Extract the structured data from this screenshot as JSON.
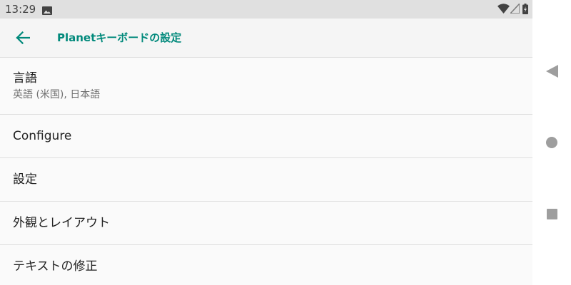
{
  "status_bar": {
    "time": "13:29",
    "icons": [
      "image-icon",
      "wifi-icon",
      "cell-signal-icon",
      "battery-icon"
    ]
  },
  "toolbar": {
    "title": "Planetキーボードの設定",
    "back_icon": "arrow-left-icon",
    "accent_color": "#00897b"
  },
  "settings": {
    "items": [
      {
        "title": "言語",
        "summary": "英語 (米国), 日本語"
      },
      {
        "title": "Configure"
      },
      {
        "title": "設定"
      },
      {
        "title": "外観とレイアウト"
      },
      {
        "title": "テキストの修正"
      }
    ]
  },
  "nav_bar": {
    "buttons": [
      "back-triangle-icon",
      "home-circle-icon",
      "recents-square-icon"
    ]
  }
}
